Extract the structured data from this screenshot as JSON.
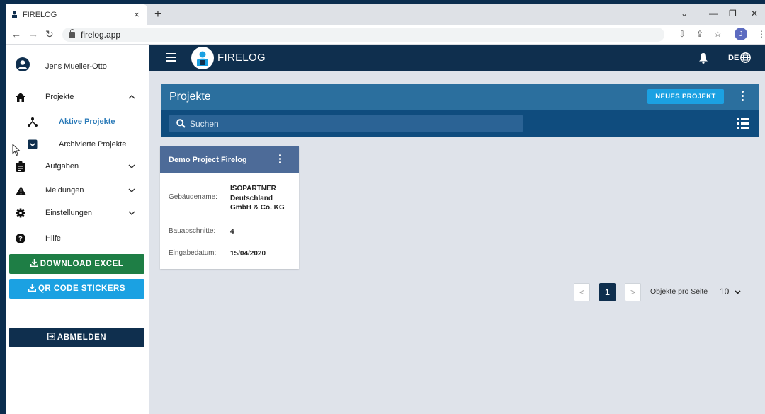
{
  "browser": {
    "tab_title": "FIRELOG",
    "tab_close": "×",
    "new_tab": "+",
    "url": "firelog.app",
    "profile_initial": "J",
    "win_minimize": "—",
    "win_restore": "❐",
    "win_close": "✕",
    "win_dropdown": "⌄"
  },
  "sidebar": {
    "user_name": "Jens Mueller-Otto",
    "items": [
      {
        "label": "Projekte",
        "icon": "home-icon",
        "chevron": "⌃"
      },
      {
        "label": "Aktive Projekte",
        "icon": "hierarchy-icon"
      },
      {
        "label": "Archivierte Projekte",
        "icon": "archive-icon"
      },
      {
        "label": "Aufgaben",
        "icon": "clipboard-icon",
        "chevron": "⌄"
      },
      {
        "label": "Meldungen",
        "icon": "warning-icon",
        "chevron": "⌄"
      },
      {
        "label": "Einstellungen",
        "icon": "gear-icon",
        "chevron": "⌄"
      },
      {
        "label": "Hilfe",
        "icon": "help-icon"
      }
    ],
    "download_excel": "DOWNLOAD EXCEL",
    "qr_stickers": "QR CODE STICKERS",
    "logout": "ABMELDEN"
  },
  "topbar": {
    "brand": "FIRELOG",
    "language": "DE"
  },
  "main": {
    "title": "Projekte",
    "new_project": "NEUES PROJEKT",
    "search_placeholder": "Suchen"
  },
  "project_card": {
    "title": "Demo Project Firelog",
    "fields": [
      {
        "label": "Gebäudename:",
        "value": "ISOPARTNER Deutschland GmbH & Co. KG"
      },
      {
        "label": "Bauabschnitte:",
        "value": "4"
      },
      {
        "label": "Eingabedatum:",
        "value": "15/04/2020"
      }
    ]
  },
  "pagination": {
    "prev": "<",
    "current_page": "1",
    "next": ">",
    "per_page_label": "Objekte pro Seite",
    "per_page_value": "10"
  },
  "colors": {
    "navy": "#0f2f4e",
    "header_blue": "#2b6f9e",
    "accent_blue": "#1ba1e2",
    "excel_green": "#1e7e45"
  }
}
